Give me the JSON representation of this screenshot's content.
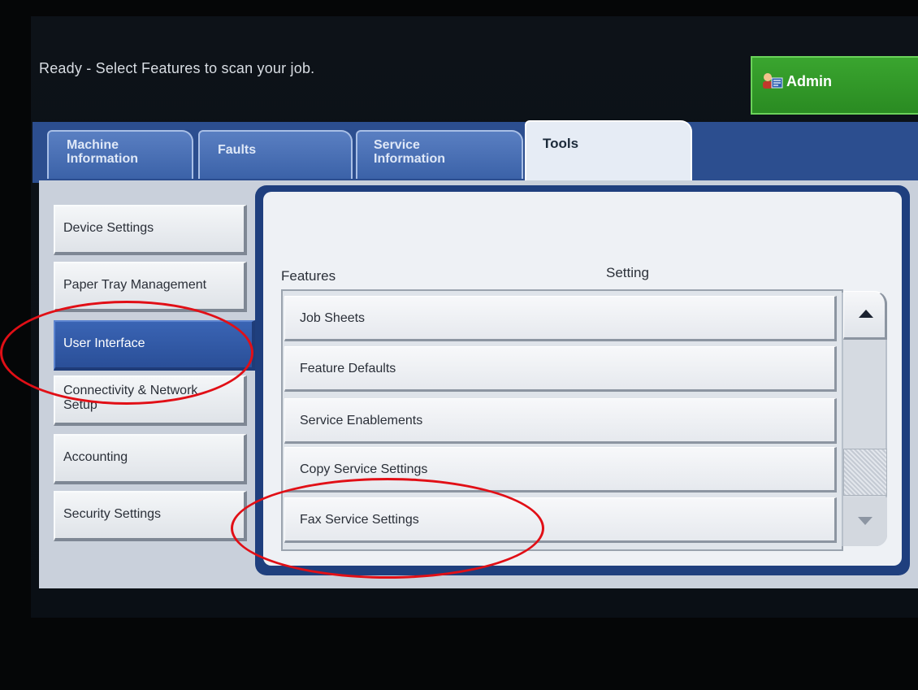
{
  "status": {
    "message": "Ready - Select Features to scan your job."
  },
  "admin": {
    "label": "Admin",
    "icon": "admin-user-icon"
  },
  "tabs": [
    {
      "label": "Machine Information",
      "line1": "Machine",
      "line2": "Information",
      "active": false
    },
    {
      "label": "Faults",
      "active": false
    },
    {
      "label": "Service Information",
      "line1": "Service",
      "line2": "Information",
      "active": false
    },
    {
      "label": "Tools",
      "active": true
    }
  ],
  "sidebar": {
    "items": [
      {
        "label": "Device Settings",
        "active": false
      },
      {
        "label": "Paper Tray Management",
        "active": false
      },
      {
        "label": "User Interface",
        "active": true
      },
      {
        "label": "Connectivity & Network Setup",
        "line1": "Connectivity & Network",
        "line2": "Setup",
        "active": false
      },
      {
        "label": "Accounting",
        "active": false
      },
      {
        "label": "Security Settings",
        "active": false
      }
    ]
  },
  "main": {
    "features_header": "Features",
    "setting_header": "Setting",
    "rows": [
      {
        "label": "Job Sheets"
      },
      {
        "label": "Feature Defaults"
      },
      {
        "label": "Service Enablements"
      },
      {
        "label": "Copy Service Settings"
      },
      {
        "label": "Fax Service Settings"
      }
    ]
  },
  "colors": {
    "tab_active": "#e6ecf5",
    "tab_inactive": "#4a70b5",
    "nav_active": "#2f58a6",
    "admin_green": "#2f9a27",
    "annotation_red": "#e10f16"
  }
}
